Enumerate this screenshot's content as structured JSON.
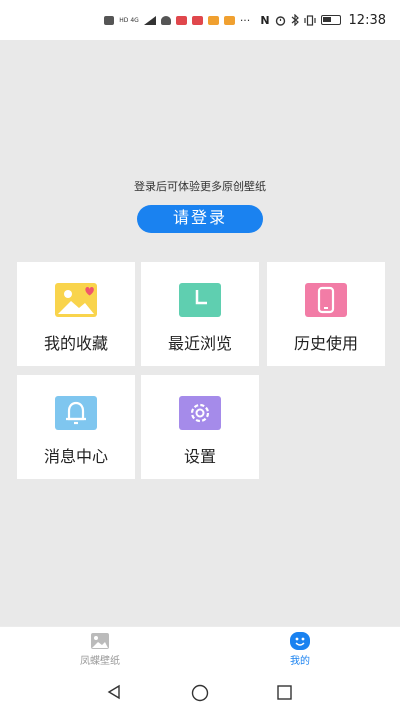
{
  "status_bar": {
    "indicators": "HD 4G",
    "more": "···",
    "time": "12:38",
    "icons": [
      "hd-icon",
      "signal-icon",
      "notification-icon",
      "app-icon-red",
      "app-icon-red",
      "app-icon-orange",
      "app-icon-orange",
      "nfc-icon",
      "alarm-icon",
      "bluetooth-icon",
      "vibrate-icon",
      "battery-icon"
    ]
  },
  "login": {
    "hint": "登录后可体验更多原创壁纸",
    "button_label": "请登录"
  },
  "grid": {
    "items": [
      {
        "label": "我的收藏",
        "icon": "favorites-image-icon",
        "color": "#f9d44c"
      },
      {
        "label": "最近浏览",
        "icon": "clock-icon",
        "color": "#5fcfb0"
      },
      {
        "label": "历史使用",
        "icon": "phone-icon",
        "color": "#f27ca6"
      },
      {
        "label": "消息中心",
        "icon": "bell-icon",
        "color": "#7fc6ef"
      },
      {
        "label": "设置",
        "icon": "gear-icon",
        "color": "#a58bea"
      }
    ]
  },
  "bottom_nav": {
    "items": [
      {
        "label": "凤蝶壁纸",
        "icon": "wallpaper-icon",
        "active": false
      },
      {
        "label": "我的",
        "icon": "smiley-icon",
        "active": true
      }
    ],
    "active_color": "#1a82f0",
    "inactive_color": "#999999"
  },
  "system_nav": {
    "icons": [
      "back-icon",
      "home-icon",
      "recents-icon"
    ]
  }
}
